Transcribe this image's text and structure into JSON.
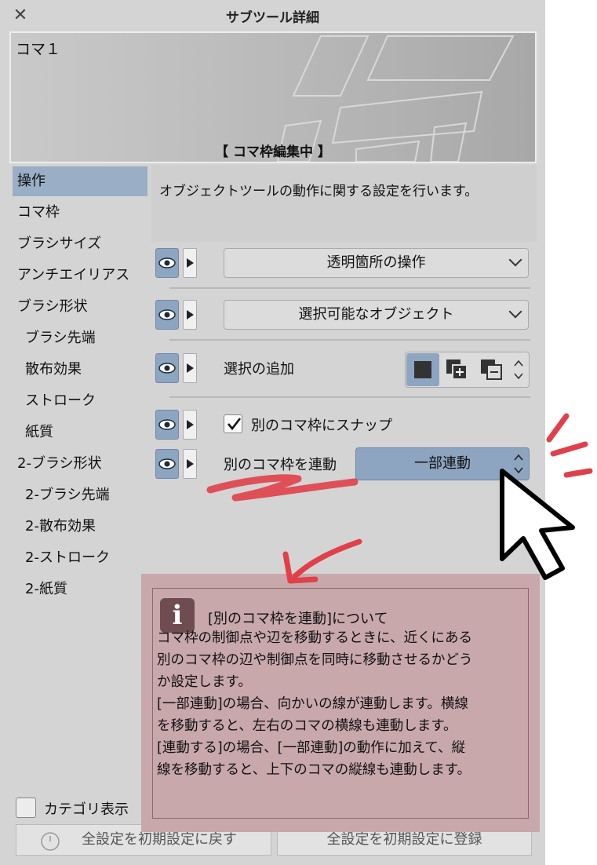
{
  "window": {
    "title": "サブツール詳細",
    "close_icon": "close-icon"
  },
  "preview": {
    "name": "コマ１",
    "caption": "【 コマ枠編集中 】"
  },
  "categories": [
    {
      "label": "操作",
      "selected": true
    },
    {
      "label": "コマ枠"
    },
    {
      "label": "ブラシサイズ"
    },
    {
      "label": "アンチエイリアス"
    },
    {
      "label": "ブラシ形状"
    },
    {
      "label": "ブラシ先端",
      "sub": true
    },
    {
      "label": "散布効果",
      "sub": true
    },
    {
      "label": "ストローク",
      "sub": true
    },
    {
      "label": "紙質",
      "sub": true
    },
    {
      "label": "2-ブラシ形状"
    },
    {
      "label": "2-ブラシ先端",
      "sub": true
    },
    {
      "label": "2-散布効果",
      "sub": true
    },
    {
      "label": "2-ストローク",
      "sub": true
    },
    {
      "label": "2-紙質",
      "sub": true
    }
  ],
  "description": "オブジェクトツールの動作に関する設定を行います。",
  "settings": {
    "transparent_op": {
      "value": "透明箇所の操作"
    },
    "selectable_objects": {
      "value": "選択可能なオブジェクト"
    },
    "add_selection": {
      "label": "選択の追加",
      "options": [
        "new-selection-icon",
        "add-selection-icon",
        "subtract-selection-icon"
      ],
      "selected_index": 0
    },
    "snap": {
      "label": "別のコマ枠にスナップ",
      "checked": true
    },
    "link": {
      "label": "別のコマ枠を連動",
      "value": "一部連動"
    }
  },
  "info": {
    "title": "[別のコマ枠を連動]について",
    "lines": [
      "コマ枠の制御点や辺を移動するときに、近くにある",
      "別のコマ枠の辺や制御点を同時に移動させるかどう",
      "か設定します。",
      "[一部連動]の場合、向かいの線が連動します。横線",
      "を移動すると、左右のコマの横線も連動します。",
      "[連動する]の場合、[一部連動]の動作に加えて、縦",
      "線を移動すると、上下のコマの縦線も連動します。"
    ]
  },
  "footer": {
    "category_toggle": "カテゴリ表示",
    "reset_button": "全設定を初期設定に戻す",
    "register_button": "全設定を初期設定に登録"
  },
  "colors": {
    "selected": "#9aaec6",
    "accent_blue": "#8ea5c1",
    "info_bg": "#c8a8ab",
    "annotation_red": "#e0404a"
  }
}
